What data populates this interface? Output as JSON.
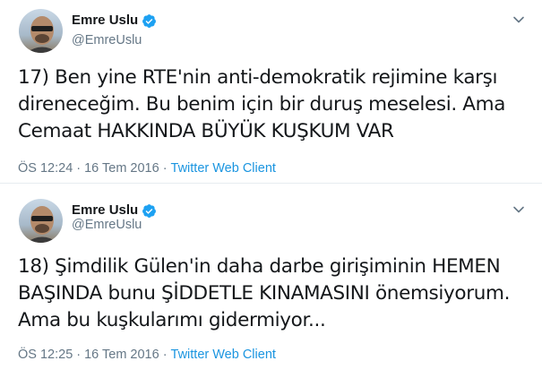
{
  "tweets": [
    {
      "author": {
        "name": "Emre Uslu",
        "handle": "@EmreUslu",
        "verified": true
      },
      "text_lines": [
        "17) Ben yine RTE'nin anti-demokratik rejimine karşı",
        "direneceğim. Bu benim için bir duruş meselesi. Ama",
        "Cemaat HAKKINDA BÜYÜK KUŞKUM VAR"
      ],
      "time": "ÖS 12:24",
      "separator": "·",
      "date": "16 Tem 2016",
      "client": "Twitter Web Client"
    },
    {
      "author": {
        "name": "Emre Uslu",
        "handle": "@EmreUslu",
        "verified": true
      },
      "text_lines": [
        "18) Şimdilik Gülen'in daha darbe girişiminin HEMEN",
        "BAŞINDA bunu ŞİDDETLE KINAMASINI önemsiyorum.",
        "Ama bu kuşkularımı gidermiyor..."
      ],
      "time": "ÖS 12:25",
      "separator": "·",
      "date": "16 Tem 2016",
      "client": "Twitter Web Client"
    }
  ],
  "colors": {
    "text": "#14171a",
    "secondary": "#657786",
    "link": "#1b95e0",
    "verified_badge": "#1da1f2",
    "divider": "#e6ecf0"
  },
  "icons": {
    "verified": "verified-badge-icon",
    "menu": "chevron-down-icon"
  }
}
